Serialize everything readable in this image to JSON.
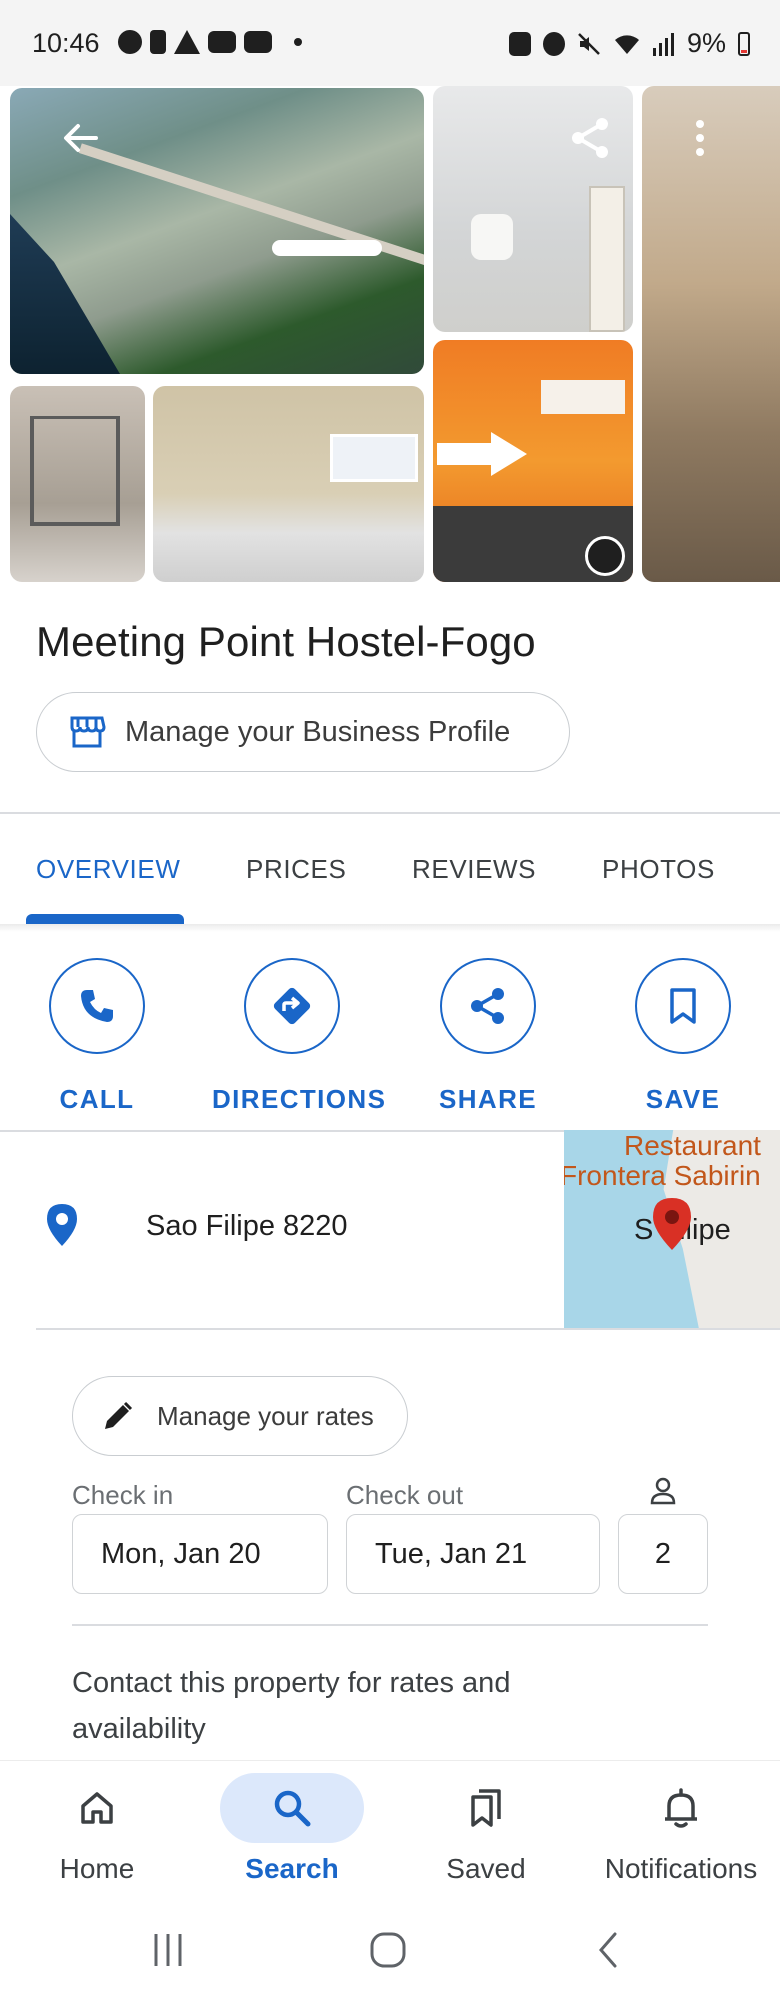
{
  "status_bar": {
    "time": "10:46",
    "battery": "9%"
  },
  "place": {
    "name": "Meeting Point Hostel-Fogo",
    "manage_profile_label": "Manage your Business Profile"
  },
  "tabs": [
    {
      "label": "OVERVIEW",
      "active": true
    },
    {
      "label": "PRICES",
      "active": false
    },
    {
      "label": "REVIEWS",
      "active": false
    },
    {
      "label": "PHOTOS",
      "active": false
    }
  ],
  "actions": [
    {
      "label": "CALL",
      "icon": "phone-icon"
    },
    {
      "label": "DIRECTIONS",
      "icon": "directions-icon"
    },
    {
      "label": "SHARE",
      "icon": "share-icon"
    },
    {
      "label": "SAVE",
      "icon": "bookmark-icon"
    }
  ],
  "address": {
    "text": "Sao Filipe 8220",
    "map_labels": {
      "line1": "Restaurant",
      "line2": "Frontera Sabirin",
      "line3": "S  Filipe"
    }
  },
  "rates": {
    "manage_label": "Manage your rates",
    "check_in_label": "Check in",
    "check_in_value": "Mon, Jan 20",
    "check_out_label": "Check out",
    "check_out_value": "Tue, Jan 21",
    "guests_value": "2",
    "contact_text": "Contact this property for rates and availability"
  },
  "bottom_nav": [
    {
      "label": "Home",
      "icon": "home-icon",
      "active": false
    },
    {
      "label": "Search",
      "icon": "search-icon",
      "active": true
    },
    {
      "label": "Saved",
      "icon": "saved-icon",
      "active": false
    },
    {
      "label": "Notifications",
      "icon": "bell-icon",
      "active": false
    }
  ],
  "colors": {
    "accent": "#1a66c8",
    "map_water": "#a8d6e8",
    "pin_red": "#d93025"
  }
}
